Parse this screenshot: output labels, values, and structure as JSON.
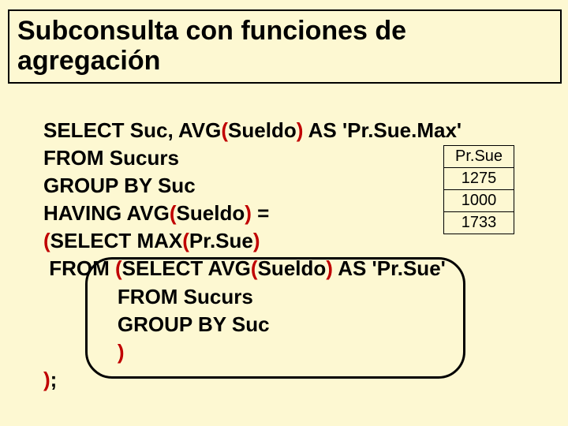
{
  "title": "Subconsulta con funciones de agregación",
  "code": {
    "l1a": "SELECT Suc, AVG",
    "l1b": "(",
    "l1c": "Sueldo",
    "l1d": ")",
    "l1e": " AS 'Pr.Sue.Max'",
    "l2": "FROM Sucurs",
    "l3": "GROUP BY Suc",
    "l4a": "HAVING AVG",
    "l4b": "(",
    "l4c": "Sueldo",
    "l4d": ")",
    "l4e": " =",
    "l5a": "(",
    "l5b": "SELECT MAX",
    "l5c": "(",
    "l5d": "Pr.Sue",
    "l5e": ")",
    "l6a": " FROM ",
    "l6b": "(",
    "l6c": "SELECT AVG",
    "l6d": "(",
    "l6e": "Sueldo",
    "l6f": ")",
    "l6g": " AS 'Pr.Sue'",
    "l7": "             FROM Sucurs",
    "l8": "             GROUP BY Suc",
    "l9a": "             ",
    "l9b": ")",
    "l10a": ")",
    "l10b": ";"
  },
  "table": {
    "header": "Pr.Sue",
    "rows": [
      "1275",
      "1000",
      "1733"
    ]
  }
}
